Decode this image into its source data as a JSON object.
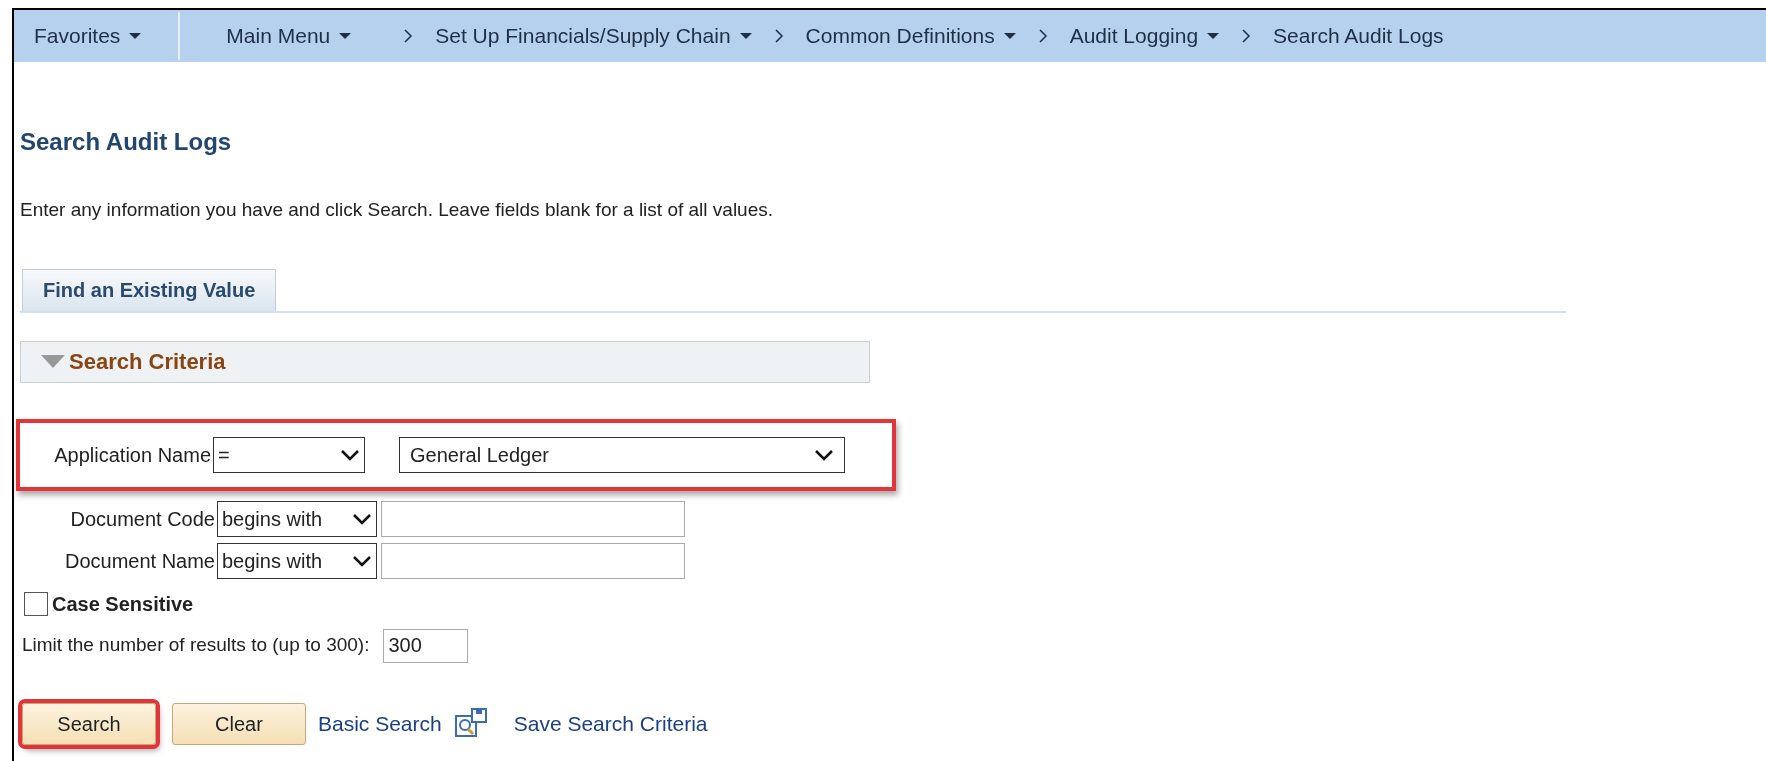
{
  "nav": {
    "items": [
      {
        "label": "Favorites",
        "has_menu": true,
        "kind": "menu"
      },
      {
        "label": "Main Menu",
        "has_menu": true,
        "kind": "menu"
      },
      {
        "label": "Set Up Financials/Supply Chain",
        "has_menu": true,
        "kind": "crumb"
      },
      {
        "label": "Common Definitions",
        "has_menu": true,
        "kind": "crumb"
      },
      {
        "label": "Audit Logging",
        "has_menu": true,
        "kind": "crumb"
      },
      {
        "label": "Search Audit Logs",
        "has_menu": false,
        "kind": "crumb"
      }
    ]
  },
  "page": {
    "title": "Search Audit Logs",
    "instructions": "Enter any information you have and click Search. Leave fields blank for a list of all values."
  },
  "tabs": [
    {
      "label": "Find an Existing Value",
      "selected": true
    }
  ],
  "section": {
    "title": "Search Criteria",
    "expanded": true
  },
  "criteria": [
    {
      "label": "Application Name",
      "operator": "=",
      "kind": "select",
      "value": "General Ledger",
      "highlighted": true
    },
    {
      "label": "Document Code",
      "operator": "begins with",
      "kind": "text",
      "highlighted": false
    },
    {
      "label": "Document Name",
      "operator": "begins with",
      "kind": "text",
      "highlighted": false
    }
  ],
  "case_sensitive": {
    "label": "Case Sensitive",
    "checked": false
  },
  "limit": {
    "label": "Limit the number of results to (up to 300):",
    "value": "300"
  },
  "actions": [
    {
      "label": "Search",
      "kind": "button",
      "highlighted": true
    },
    {
      "label": "Clear",
      "kind": "button",
      "highlighted": false
    },
    {
      "label": "Basic Search",
      "kind": "link",
      "highlighted": false
    },
    {
      "label": "Save Search Criteria",
      "kind": "icon-link",
      "highlighted": false
    }
  ]
}
